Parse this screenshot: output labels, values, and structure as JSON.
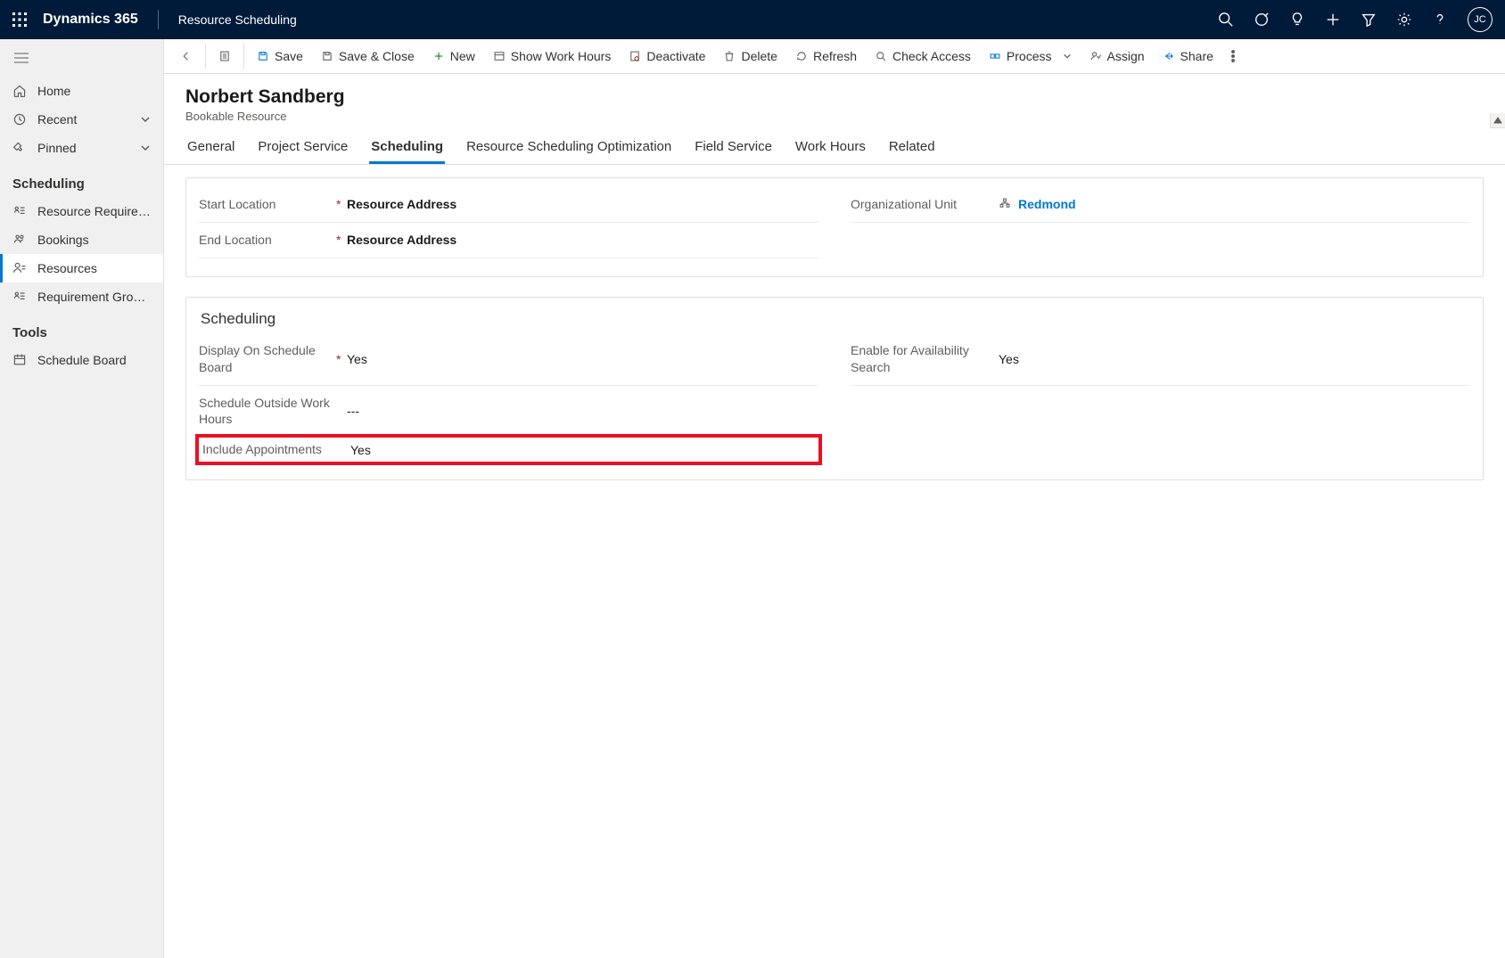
{
  "topbar": {
    "brand": "Dynamics 365",
    "app": "Resource Scheduling",
    "avatar": "JC"
  },
  "sidebar": {
    "home": "Home",
    "recent": "Recent",
    "pinned": "Pinned",
    "group1": "Scheduling",
    "items1": {
      "rr": "Resource Requireme…",
      "bk": "Bookings",
      "res": "Resources",
      "rg": "Requirement Groups"
    },
    "group2": "Tools",
    "items2": {
      "sb": "Schedule Board"
    }
  },
  "cmdbar": {
    "save": "Save",
    "saveclose": "Save & Close",
    "new": "New",
    "showhours": "Show Work Hours",
    "deactivate": "Deactivate",
    "delete": "Delete",
    "refresh": "Refresh",
    "checkaccess": "Check Access",
    "process": "Process",
    "assign": "Assign",
    "share": "Share"
  },
  "record": {
    "title": "Norbert Sandberg",
    "subtitle": "Bookable Resource"
  },
  "tabs": {
    "general": "General",
    "project": "Project Service",
    "scheduling": "Scheduling",
    "rso": "Resource Scheduling Optimization",
    "fieldservice": "Field Service",
    "workhours": "Work Hours",
    "related": "Related"
  },
  "form": {
    "sec1": {
      "startloc_label": "Start Location",
      "startloc_value": "Resource Address",
      "endloc_label": "End Location",
      "endloc_value": "Resource Address",
      "orgunit_label": "Organizational Unit",
      "orgunit_value": "Redmond"
    },
    "sec2": {
      "title": "Scheduling",
      "display_label": "Display On Schedule Board",
      "display_value": "Yes",
      "outside_label": "Schedule Outside Work Hours",
      "outside_value": "---",
      "include_label": "Include Appointments",
      "include_value": "Yes",
      "enable_label": "Enable for Availability Search",
      "enable_value": "Yes"
    }
  }
}
